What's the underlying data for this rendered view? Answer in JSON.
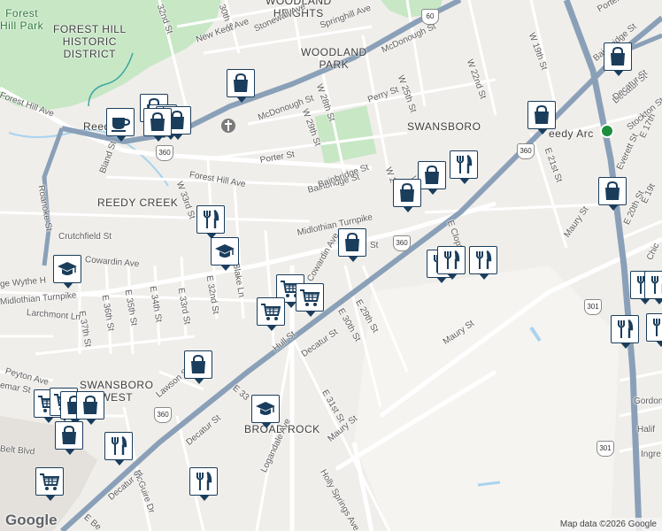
{
  "map": {
    "attribution": "Map data ©2026 Google",
    "logo": "Google",
    "colors": {
      "background": "#f0eeea",
      "park": "#c7e7c5",
      "road": "#ffffff",
      "highway": "#8aa0b8",
      "water": "#a9d3ee",
      "pin_border": "#1a3d5c"
    }
  },
  "areas": [
    {
      "id": "forest-hill-park",
      "text": "Forest\nHill Park"
    },
    {
      "id": "forest-hill-historic",
      "text": "FOREST HILL\nHISTORIC\nDISTRICT"
    },
    {
      "id": "woodland-heights",
      "text": "WOODLAND\nHEIGHTS"
    },
    {
      "id": "woodland-park",
      "text": "WOODLAND\nPARK"
    },
    {
      "id": "swansboro",
      "text": "SWANSBORO"
    },
    {
      "id": "reedy-creek",
      "text": "REEDY CREEK"
    },
    {
      "id": "swansboro-west",
      "text": "SWANSBORO\nWEST"
    },
    {
      "id": "broad-rock",
      "text": "BROAD ROCK"
    },
    {
      "id": "redy-arc",
      "text": "eedy Arc"
    },
    {
      "id": "reed-church",
      "text": "Reed          Church"
    }
  ],
  "streets": [
    {
      "id": "s1",
      "text": "32nd St"
    },
    {
      "id": "s2",
      "text": "30th St"
    },
    {
      "id": "s3",
      "text": "New Kent Ave"
    },
    {
      "id": "s4",
      "text": "Stonewall Ave"
    },
    {
      "id": "s5",
      "text": "Springhill Ave"
    },
    {
      "id": "s6",
      "text": "McDonough St"
    },
    {
      "id": "s7",
      "text": "W 22nd St"
    },
    {
      "id": "s8",
      "text": "W 19th St"
    },
    {
      "id": "s9",
      "text": "Porter St"
    },
    {
      "id": "s10",
      "text": "Bainbridge St"
    },
    {
      "id": "s11",
      "text": "Decatur St"
    },
    {
      "id": "s12",
      "text": "Stockton St"
    },
    {
      "id": "s13",
      "text": "Perry St"
    },
    {
      "id": "s14",
      "text": "W 25th St"
    },
    {
      "id": "s15",
      "text": "W 28th St"
    },
    {
      "id": "s16",
      "text": "W 29th St"
    },
    {
      "id": "s17",
      "text": "McDonough St"
    },
    {
      "id": "s18",
      "text": "Porter St"
    },
    {
      "id": "s19",
      "text": "Forest Hill Ave"
    },
    {
      "id": "s20",
      "text": "Forest Hill Ave"
    },
    {
      "id": "s21",
      "text": "Bainbridge St"
    },
    {
      "id": "s22",
      "text": "Bland St"
    },
    {
      "id": "s23",
      "text": "W 33rd St"
    },
    {
      "id": "s24",
      "text": "Roanoke St"
    },
    {
      "id": "s25",
      "text": "Crutchfield St"
    },
    {
      "id": "s26",
      "text": "Midlothian Turnpike"
    },
    {
      "id": "s27",
      "text": "Midlothian Turnpike"
    },
    {
      "id": "s28",
      "text": "Blake Ln"
    },
    {
      "id": "s29",
      "text": "E 32nd St"
    },
    {
      "id": "s30",
      "text": "E 33rd St"
    },
    {
      "id": "s31",
      "text": "E 34th St"
    },
    {
      "id": "s32",
      "text": "E 35th St"
    },
    {
      "id": "s33",
      "text": "E 36th St"
    },
    {
      "id": "s34",
      "text": "E 37th St"
    },
    {
      "id": "s35",
      "text": "Larchmont Ln"
    },
    {
      "id": "s36",
      "text": "Hull St"
    },
    {
      "id": "s37",
      "text": "E 30th St"
    },
    {
      "id": "s38",
      "text": "E 29th St"
    },
    {
      "id": "s39",
      "text": "Decatur St"
    },
    {
      "id": "s40",
      "text": "Maury St"
    },
    {
      "id": "s41",
      "text": "Maury St"
    },
    {
      "id": "s42",
      "text": "E 31st St"
    },
    {
      "id": "s43",
      "text": "Lawson St"
    },
    {
      "id": "s44",
      "text": "Peyton Ave"
    },
    {
      "id": "s45",
      "text": "Belt Blvd"
    },
    {
      "id": "s46",
      "text": "Decatur St"
    },
    {
      "id": "s47",
      "text": "McGuire Dr"
    },
    {
      "id": "s48",
      "text": "Decatur St"
    },
    {
      "id": "s49",
      "text": "Logandale Ave"
    },
    {
      "id": "s50",
      "text": "Holly Springs Ave"
    },
    {
      "id": "s51",
      "text": "E 21st St"
    },
    {
      "id": "s52",
      "text": "Maury St"
    },
    {
      "id": "s53",
      "text": "Gordon"
    },
    {
      "id": "s54",
      "text": "Halif"
    },
    {
      "id": "s55",
      "text": "Ingre"
    },
    {
      "id": "s56",
      "text": "E 20th St"
    },
    {
      "id": "s57",
      "text": "E 17th"
    },
    {
      "id": "s58",
      "text": "E 19t"
    },
    {
      "id": "s59",
      "text": "E Clopton"
    },
    {
      "id": "s60",
      "text": "E 33"
    },
    {
      "id": "s61",
      "text": "E Be"
    },
    {
      "id": "s62",
      "text": "Bainbridge St"
    },
    {
      "id": "s63",
      "text": "Decatur St"
    },
    {
      "id": "s64",
      "text": "Everett St"
    },
    {
      "id": "s65",
      "text": "Chic"
    },
    {
      "id": "s66",
      "text": "W 2"
    },
    {
      "id": "s67",
      "text": "W 2"
    },
    {
      "id": "s68",
      "text": "St"
    },
    {
      "id": "s69",
      "text": "Cowardin Ave"
    },
    {
      "id": "s70",
      "text": "Cowardin Ave"
    },
    {
      "id": "s71",
      "text": "emar St"
    },
    {
      "id": "s72",
      "text": "ge Wythe H"
    }
  ],
  "shields": [
    "60",
    "360",
    "360",
    "360",
    "301",
    "301",
    "360"
  ],
  "pins": [
    {
      "id": "p1",
      "type": "grocery"
    },
    {
      "id": "p2",
      "type": "grocery"
    },
    {
      "id": "p3",
      "type": "cafe"
    },
    {
      "id": "p4",
      "type": "grocery"
    },
    {
      "id": "p5",
      "type": "grocery"
    },
    {
      "id": "p6",
      "type": "grocery"
    },
    {
      "id": "p7",
      "type": "grocery"
    },
    {
      "id": "p8",
      "type": "grocery"
    },
    {
      "id": "p9",
      "type": "restaurant"
    },
    {
      "id": "p10",
      "type": "grocery"
    },
    {
      "id": "p11",
      "type": "grocery"
    },
    {
      "id": "p12",
      "type": "restaurant"
    },
    {
      "id": "p13",
      "type": "school"
    },
    {
      "id": "p14",
      "type": "grocery"
    },
    {
      "id": "p15",
      "type": "school"
    },
    {
      "id": "p16",
      "type": "restaurant"
    },
    {
      "id": "p17",
      "type": "restaurant"
    },
    {
      "id": "p18",
      "type": "restaurant"
    },
    {
      "id": "p19",
      "type": "supermarket"
    },
    {
      "id": "p20",
      "type": "supermarket"
    },
    {
      "id": "p21",
      "type": "supermarket"
    },
    {
      "id": "p22",
      "type": "grocery"
    },
    {
      "id": "p23",
      "type": "supermarket"
    },
    {
      "id": "p24",
      "type": "supermarket"
    },
    {
      "id": "p25",
      "type": "grocery"
    },
    {
      "id": "p26",
      "type": "grocery"
    },
    {
      "id": "p27",
      "type": "school"
    },
    {
      "id": "p28",
      "type": "restaurant"
    },
    {
      "id": "p29",
      "type": "supermarket"
    },
    {
      "id": "p30",
      "type": "restaurant"
    },
    {
      "id": "p31",
      "type": "restaurant"
    },
    {
      "id": "p32",
      "type": "restaurant"
    },
    {
      "id": "p33",
      "type": "restaurant"
    },
    {
      "id": "p34",
      "type": "grocery"
    },
    {
      "id": "p35",
      "type": "restaurant"
    },
    {
      "id": "p36",
      "type": "grocery"
    },
    {
      "id": "p37",
      "type": "grocery"
    }
  ]
}
